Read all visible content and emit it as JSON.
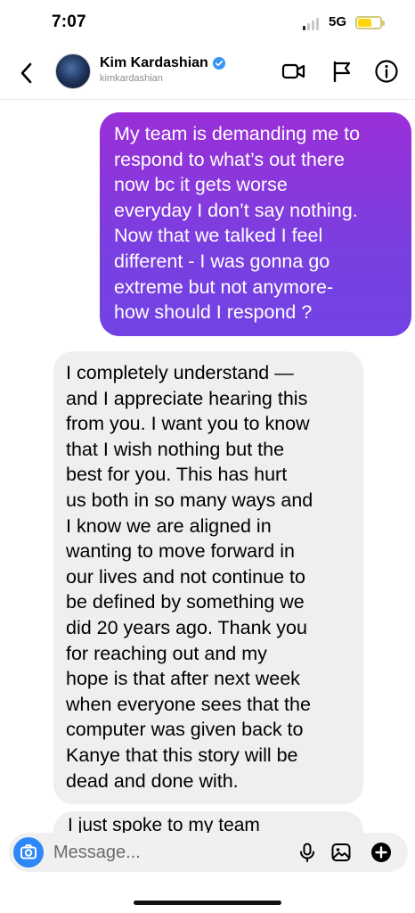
{
  "status_bar": {
    "time": "7:07",
    "network": "5G"
  },
  "header": {
    "name": "Kim Kardashian",
    "handle": "kimkardashian",
    "icons": [
      "back-icon",
      "verified-icon",
      "video-call-icon",
      "flag-icon",
      "info-icon"
    ]
  },
  "messages": {
    "sent": {
      "lines": [
        "My team is demanding me to",
        "respond to what’s out there",
        "now bc it gets worse",
        "everyday I don’t say nothing.",
        "Now that we talked I feel",
        "different - I was gonna go",
        "extreme but not anymore-",
        "how should I respond ?"
      ]
    },
    "received": {
      "lines": [
        "I completely understand —",
        "and I appreciate hearing this",
        "from you. I want you to know",
        "that I wish nothing but the",
        "best for you. This has hurt",
        "us both in so many ways and",
        "I know we are aligned in",
        "wanting to move forward in",
        "our lives and not continue to",
        "be defined by something we",
        "did 20 years ago. Thank you",
        "for reaching out and my",
        "hope is that after next week",
        "when everyone sees that the",
        "computer was given back to",
        "Kanye that this story will be",
        "dead and done with."
      ]
    },
    "next_partial": "I just spoke to my team"
  },
  "composer": {
    "placeholder": "Message...",
    "icons": [
      "camera-icon",
      "mic-icon",
      "gallery-icon",
      "plus-icon"
    ]
  },
  "colors": {
    "sent_bubble_top": "#9a2fd8",
    "sent_bubble_bottom": "#7243e4",
    "received_bubble": "#efefef",
    "camera_button": "#2f86f6",
    "verified": "#3897f0"
  }
}
